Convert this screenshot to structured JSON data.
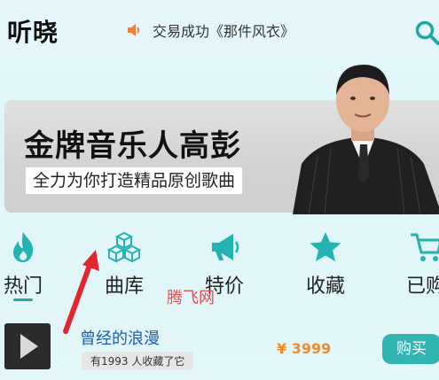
{
  "header": {
    "app_title": "听晓",
    "notice_text": "交易成功《那件风衣》",
    "icons": [
      "speaker-icon",
      "search-icon"
    ]
  },
  "banner": {
    "title": "金牌音乐人高彭",
    "subtitle": "全力为你打造精品原创歌曲"
  },
  "categories": [
    {
      "label": "热门",
      "icon": "flame-icon",
      "selected": true
    },
    {
      "label": "曲库",
      "icon": "cubes-icon"
    },
    {
      "label": "特价",
      "icon": "megaphone-icon"
    },
    {
      "label": "收藏",
      "icon": "star-icon"
    },
    {
      "label": "已购",
      "icon": "cart-icon"
    }
  ],
  "watermark": "腾飞网",
  "list": [
    {
      "title": "曾经的浪漫",
      "collect_count": "有1993 人收藏了它",
      "price": "¥ 3999",
      "buy_label": "购买"
    }
  ],
  "colors": {
    "accent": "#32b4b3",
    "price": "#f2892b",
    "link": "#1c5fb0"
  }
}
